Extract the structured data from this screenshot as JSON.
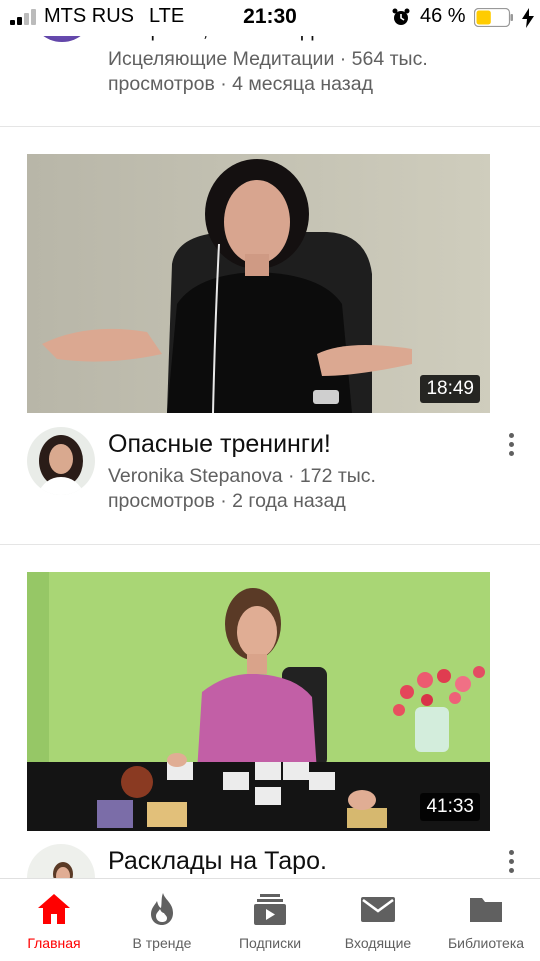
{
  "status_bar": {
    "carrier": "MTS RUS",
    "network": "LTE",
    "time": "21:30",
    "battery": "46 %",
    "battery_level": 0.46,
    "alarm_icon": "alarm-clock-icon",
    "charge_icon": "lightning-icon"
  },
  "videos": [
    {
      "title": "от щения, освобождения и...",
      "channel_views": "Исцеляющие Медитации · 564 тыс.",
      "age": "просмотров · 4 месяца назад"
    },
    {
      "title": "Опасные тренинги!",
      "channel_views": "Veronika Stepanova · 172 тыс.",
      "age": "просмотров · 2 года назад",
      "duration": "18:49"
    },
    {
      "title": "Расклады на Таро.",
      "duration": "41:33"
    }
  ],
  "bottom_nav": [
    {
      "label": "Главная",
      "icon": "home-icon",
      "active": true
    },
    {
      "label": "В тренде",
      "icon": "flame-icon",
      "active": false
    },
    {
      "label": "Подписки",
      "icon": "subscriptions-icon",
      "active": false
    },
    {
      "label": "Входящие",
      "icon": "inbox-mail-icon",
      "active": false
    },
    {
      "label": "Библиотека",
      "icon": "folder-icon",
      "active": false
    }
  ],
  "colors": {
    "accent": "#ff0000",
    "text": "#0f0f0f",
    "secondary_text": "#606060",
    "battery_fill": "#ffcc00"
  }
}
